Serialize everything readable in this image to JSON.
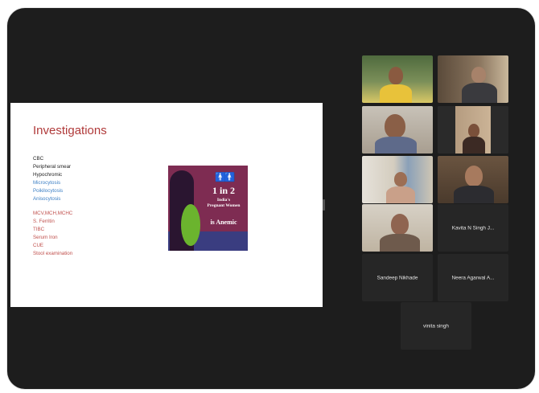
{
  "window": {
    "corner_label": ""
  },
  "slide": {
    "title": "Investigations",
    "bullets": [
      {
        "text": "CBC",
        "color": "black"
      },
      {
        "text": "Peripheral smear",
        "color": "black"
      },
      {
        "text": "Hypochromic",
        "color": "black"
      },
      {
        "text": "Microcytosis",
        "color": "blue"
      },
      {
        "text": "Poikilocytosis",
        "color": "blue"
      },
      {
        "text": "Anisocytosis",
        "color": "blue"
      },
      {
        "text": "MCV,MCH,MCHC",
        "color": "red"
      },
      {
        "text": "S. Ferritin",
        "color": "red"
      },
      {
        "text": "TIBC",
        "color": "red"
      },
      {
        "text": "Serum Iron",
        "color": "red"
      },
      {
        "text": "CUE",
        "color": "red"
      },
      {
        "text": "Stool examination",
        "color": "red"
      }
    ],
    "poster": {
      "stat": "1 in 2",
      "line1": "India's",
      "line2": "Pregnant Women",
      "line3": "is Anemic",
      "colors": {
        "top": "#7e2c52",
        "bottom": "#3a3d80",
        "accent": "#6bb42e"
      }
    }
  },
  "participants": [
    {
      "name": "",
      "video": true
    },
    {
      "name": "",
      "video": true
    },
    {
      "name": "",
      "video": true
    },
    {
      "name": "",
      "video": true
    },
    {
      "name": "",
      "video": true
    },
    {
      "name": "",
      "video": true
    },
    {
      "name": "",
      "video": true
    },
    {
      "name": "Kavita N Singh J...",
      "video": false
    },
    {
      "name": "Sandeep Nikhade",
      "video": false
    },
    {
      "name": "Neera Agarwal A...",
      "video": false
    },
    {
      "name": "vinita singh",
      "video": false
    }
  ],
  "colors": {
    "background": "#1d1d1d",
    "tile": "#262626",
    "accent_title": "#b03a3a",
    "active_speaker": "#6fbf3e"
  }
}
